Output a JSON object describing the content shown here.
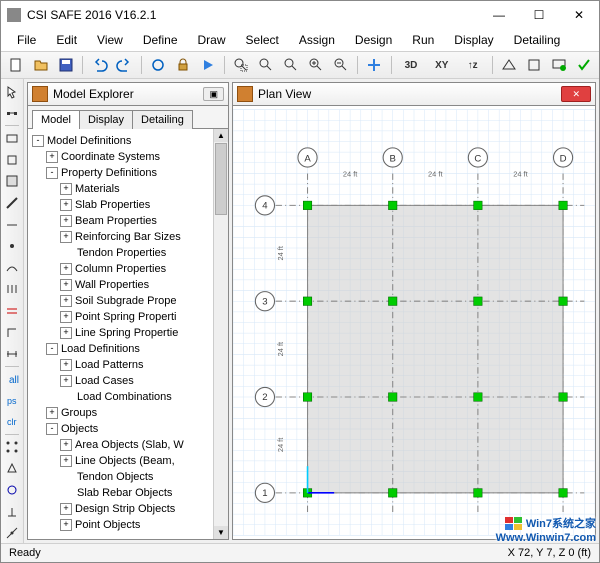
{
  "title": "CSI SAFE 2016 V16.2.1",
  "window_controls": {
    "min": "—",
    "max": "☐",
    "close": "✕"
  },
  "menu": [
    "File",
    "Edit",
    "View",
    "Define",
    "Draw",
    "Select",
    "Assign",
    "Design",
    "Run",
    "Display",
    "Detailing"
  ],
  "toolbar_text": {
    "threeD": "3D",
    "xy": "XY",
    "tz": "↑z"
  },
  "model_explorer": {
    "title": "Model Explorer",
    "restore": "▣",
    "tabs": [
      "Model",
      "Display",
      "Detailing"
    ],
    "tree": [
      {
        "d": 0,
        "e": "-",
        "t": "Model Definitions"
      },
      {
        "d": 1,
        "e": "+",
        "t": "Coordinate Systems"
      },
      {
        "d": 1,
        "e": "-",
        "t": "Property Definitions"
      },
      {
        "d": 2,
        "e": "+",
        "t": "Materials"
      },
      {
        "d": 2,
        "e": "+",
        "t": "Slab Properties"
      },
      {
        "d": 2,
        "e": "+",
        "t": "Beam Properties"
      },
      {
        "d": 2,
        "e": "+",
        "t": "Reinforcing Bar Sizes"
      },
      {
        "d": 2,
        "e": " ",
        "t": "Tendon Properties"
      },
      {
        "d": 2,
        "e": "+",
        "t": "Column Properties"
      },
      {
        "d": 2,
        "e": "+",
        "t": "Wall Properties"
      },
      {
        "d": 2,
        "e": "+",
        "t": "Soil Subgrade Prope"
      },
      {
        "d": 2,
        "e": "+",
        "t": "Point Spring Properti"
      },
      {
        "d": 2,
        "e": "+",
        "t": "Line Spring Propertie"
      },
      {
        "d": 1,
        "e": "-",
        "t": "Load Definitions"
      },
      {
        "d": 2,
        "e": "+",
        "t": "Load Patterns"
      },
      {
        "d": 2,
        "e": "+",
        "t": "Load Cases"
      },
      {
        "d": 2,
        "e": " ",
        "t": "Load Combinations"
      },
      {
        "d": 1,
        "e": "+",
        "t": "Groups"
      },
      {
        "d": 1,
        "e": "-",
        "t": "Objects"
      },
      {
        "d": 2,
        "e": "+",
        "t": "Area Objects (Slab, W"
      },
      {
        "d": 2,
        "e": "+",
        "t": "Line Objects (Beam, "
      },
      {
        "d": 2,
        "e": " ",
        "t": "Tendon Objects"
      },
      {
        "d": 2,
        "e": " ",
        "t": "Slab Rebar Objects"
      },
      {
        "d": 2,
        "e": "+",
        "t": "Design Strip Objects"
      },
      {
        "d": 2,
        "e": "+",
        "t": "Point Objects"
      }
    ]
  },
  "plan_view": {
    "title": "Plan View",
    "close": "✕",
    "cols": [
      "A",
      "B",
      "C",
      "D"
    ],
    "rows": [
      "4",
      "3",
      "2",
      "1"
    ],
    "dim": "24 ft"
  },
  "status": {
    "left": "Ready",
    "right": "X 72,  Y 7,  Z 0  (ft)"
  },
  "watermark": {
    "line1": "Win7系统之家",
    "line2": "Www.Winwin7.com"
  }
}
